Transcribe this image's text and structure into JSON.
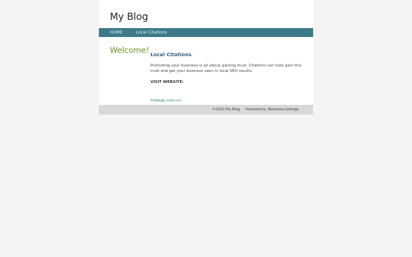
{
  "site": {
    "title": "My Blog"
  },
  "nav": {
    "items": [
      {
        "label": "HOME"
      },
      {
        "label": "Local Citations"
      }
    ]
  },
  "main": {
    "welcome": "Welcome!",
    "article": {
      "title": "Local Citations",
      "body": "Promoting your business is all about gaining trust. Citations can help gain this trust and get your business seen in local SEO results.",
      "visit_label": "VISIT WEBSITE:",
      "visit_link": "freeapp.com.ua"
    }
  },
  "footer": {
    "copyright": "©2025 My Blog",
    "powered_prefix": "Powered by",
    "powered_link": "Business Listings"
  },
  "colors": {
    "nav_bar": "#3d7a8a",
    "welcome": "#6b8e23",
    "article_title": "#2f5f7f",
    "footer_bg": "#d8d8d8",
    "page_bg": "#f4f4f4"
  }
}
